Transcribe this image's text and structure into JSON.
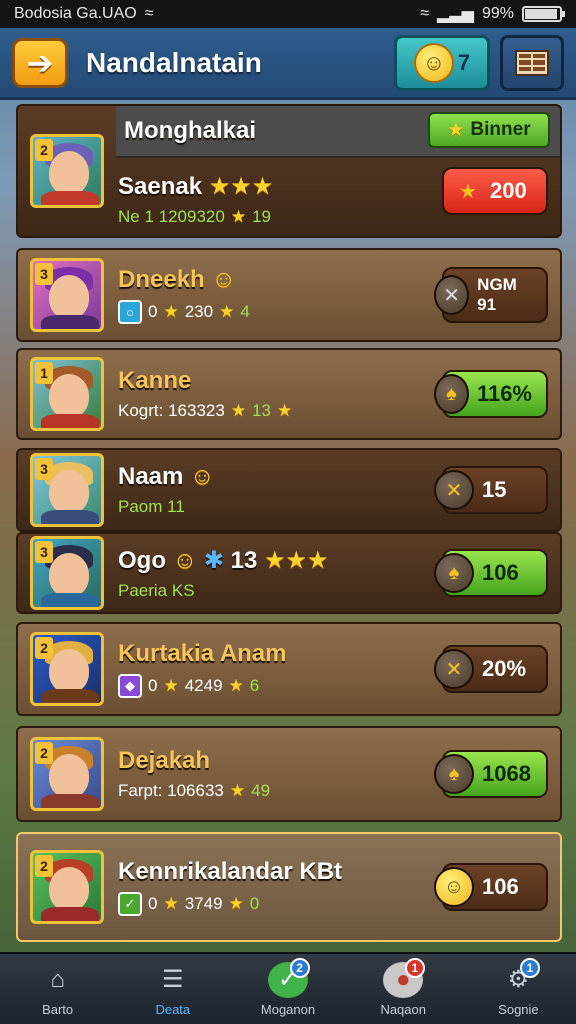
{
  "status_bar": {
    "left_text": "Bodosia Ga.UAO",
    "battery_text": "99%",
    "battery_level": 0.99
  },
  "header": {
    "back_icon": "arrow-left-icon",
    "title": "Nandalnatain",
    "coins_count": "7",
    "coin_icon": "smiley-coin-icon",
    "menu_icon": "grid-menu-icon"
  },
  "cards": [
    {
      "header_name": "Monghalkai",
      "banner": "Binner",
      "name": "Saenak",
      "sub_text": "Ne 1 1209320",
      "sub_extra": "19",
      "reward": "200",
      "reward_style": "red"
    },
    {
      "name": "Dneekh",
      "sub_num": "0",
      "sub_text": "230",
      "sub_extra": "4",
      "reward": "NGM 91",
      "reward_style": "brown"
    },
    {
      "name": "Kanne",
      "sub_text": "Kogrt: 163323",
      "sub_extra": "13",
      "reward": "116%",
      "reward_style": "green"
    },
    {
      "name": "Naam",
      "sub_text": "Paom 11",
      "reward": "15",
      "reward_style": "brown"
    },
    {
      "name": "Ogo",
      "name_extra": "13",
      "sub_text": "Paeria KS",
      "reward": "106",
      "reward_style": "green"
    },
    {
      "name": "Kurtakia Anam",
      "sub_num": "0",
      "sub_text": "4249",
      "sub_extra": "6",
      "reward": "20%",
      "reward_style": "brown"
    },
    {
      "name": "Dejakah",
      "sub_text": "Farpt: 106633",
      "sub_extra": "49",
      "reward": "1068",
      "reward_style": "green"
    },
    {
      "name": "Kennrikalandar KBt",
      "sub_num": "0",
      "sub_text": "3749",
      "sub_extra": "0",
      "reward": "106",
      "reward_style": "brown"
    }
  ],
  "bottom_nav": [
    {
      "label": "Barto",
      "icon": "home-icon"
    },
    {
      "label": "Deata",
      "icon": "list-icon",
      "active": true
    },
    {
      "label": "Moganon",
      "icon": "check-badge-icon",
      "badge": "2"
    },
    {
      "label": "Naqaon",
      "icon": "chat-icon",
      "badge": "1"
    },
    {
      "label": "Sognie",
      "icon": "gear-icon",
      "badge": "1"
    }
  ]
}
